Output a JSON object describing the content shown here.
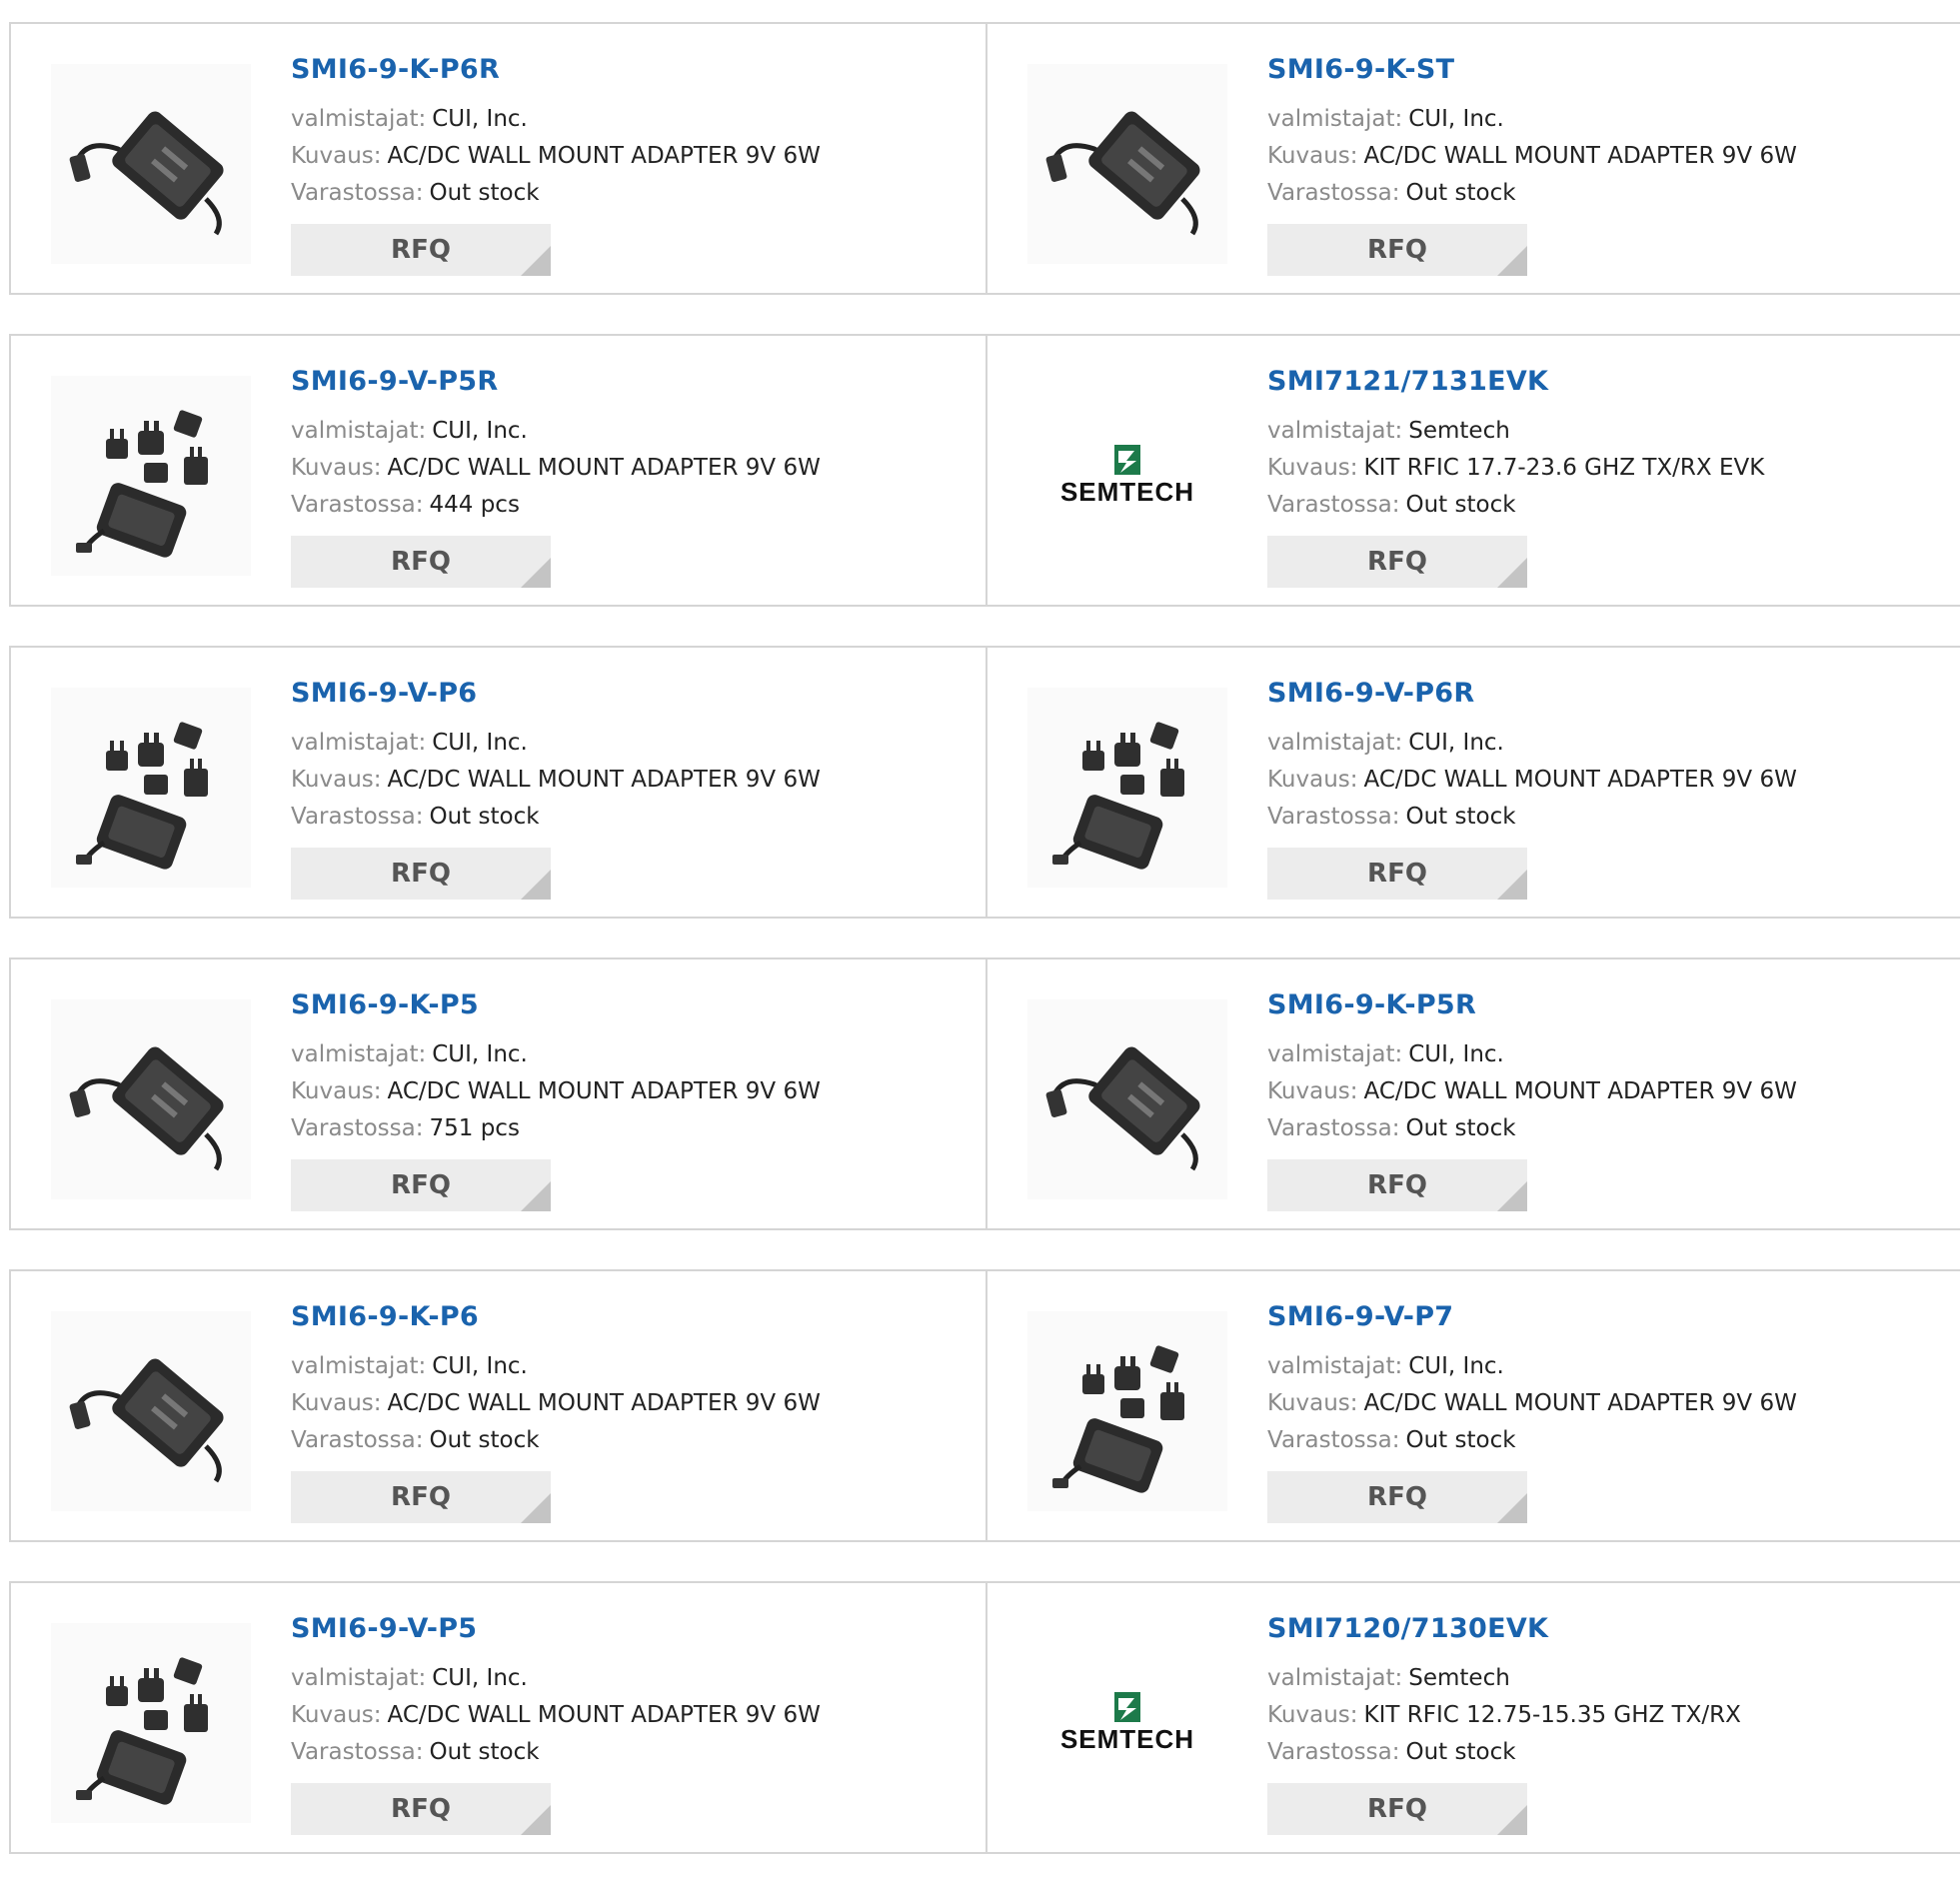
{
  "labels": {
    "manufacturer": "valmistajat:",
    "description": "Kuvaus:",
    "stock": "Varastossa:",
    "rfq": "RFQ"
  },
  "products": [
    {
      "pn": "SMI6-9-K-P6R",
      "mfr": "CUI, Inc.",
      "desc": "AC/DC WALL MOUNT ADAPTER 9V 6W",
      "stock": "Out stock",
      "image": "adapter-plain"
    },
    {
      "pn": "SMI6-9-K-ST",
      "mfr": "CUI, Inc.",
      "desc": "AC/DC WALL MOUNT ADAPTER 9V 6W",
      "stock": "Out stock",
      "image": "adapter-plain"
    },
    {
      "pn": "SMI6-9-V-P5R",
      "mfr": "CUI, Inc.",
      "desc": "AC/DC WALL MOUNT ADAPTER 9V 6W",
      "stock": "444 pcs",
      "image": "adapter-plugs"
    },
    {
      "pn": "SMI7121/7131EVK",
      "mfr": "Semtech",
      "desc": "KIT RFIC 17.7-23.6 GHZ TX/RX EVK",
      "stock": "Out stock",
      "image": "semtech-logo"
    },
    {
      "pn": "SMI6-9-V-P6",
      "mfr": "CUI, Inc.",
      "desc": "AC/DC WALL MOUNT ADAPTER 9V 6W",
      "stock": "Out stock",
      "image": "adapter-plugs"
    },
    {
      "pn": "SMI6-9-V-P6R",
      "mfr": "CUI, Inc.",
      "desc": "AC/DC WALL MOUNT ADAPTER 9V 6W",
      "stock": "Out stock",
      "image": "adapter-plugs"
    },
    {
      "pn": "SMI6-9-K-P5",
      "mfr": "CUI, Inc.",
      "desc": "AC/DC WALL MOUNT ADAPTER 9V 6W",
      "stock": "751 pcs",
      "image": "adapter-plain"
    },
    {
      "pn": "SMI6-9-K-P5R",
      "mfr": "CUI, Inc.",
      "desc": "AC/DC WALL MOUNT ADAPTER 9V 6W",
      "stock": "Out stock",
      "image": "adapter-plain"
    },
    {
      "pn": "SMI6-9-K-P6",
      "mfr": "CUI, Inc.",
      "desc": "AC/DC WALL MOUNT ADAPTER 9V 6W",
      "stock": "Out stock",
      "image": "adapter-plain"
    },
    {
      "pn": "SMI6-9-V-P7",
      "mfr": "CUI, Inc.",
      "desc": "AC/DC WALL MOUNT ADAPTER 9V 6W",
      "stock": "Out stock",
      "image": "adapter-plugs"
    },
    {
      "pn": "SMI6-9-V-P5",
      "mfr": "CUI, Inc.",
      "desc": "AC/DC WALL MOUNT ADAPTER 9V 6W",
      "stock": "Out stock",
      "image": "adapter-plugs"
    },
    {
      "pn": "SMI7120/7130EVK",
      "mfr": "Semtech",
      "desc": "KIT RFIC 12.75-15.35 GHZ TX/RX",
      "stock": "Out stock",
      "image": "semtech-logo"
    }
  ],
  "logo_text": "SEMTECH",
  "colors": {
    "link": "#1a63ad",
    "label": "#8a8a8a",
    "border": "#d5d5d5",
    "button_bg": "#ececec"
  }
}
